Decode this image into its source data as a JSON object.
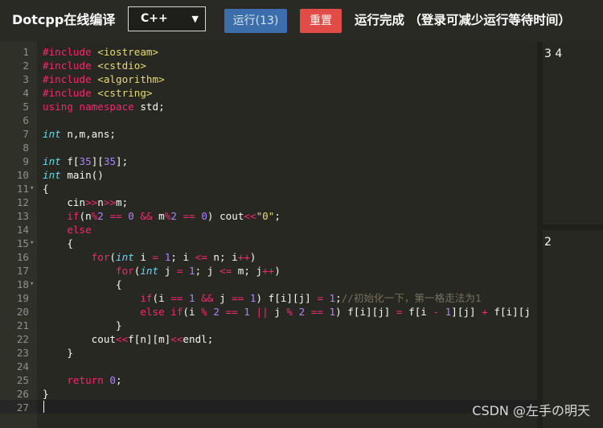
{
  "header": {
    "brand": "Dotcpp在线编译",
    "language": "C++",
    "run_label": "运行(13)",
    "reset_label": "重置",
    "status": "运行完成 （登录可减少运行等待时间）"
  },
  "editor": {
    "line_numbers": [
      "1",
      "2",
      "3",
      "4",
      "5",
      "6",
      "7",
      "8",
      "9",
      "10",
      "11",
      "12",
      "13",
      "14",
      "15",
      "16",
      "17",
      "18",
      "19",
      "20",
      "21",
      "22",
      "23",
      "24",
      "25",
      "26",
      "27"
    ],
    "fold_markers": {
      "11": "▾",
      "15": "▾",
      "18": "▾"
    },
    "lines": [
      [
        [
          "k",
          "#include "
        ],
        [
          "s",
          "<iostream>"
        ]
      ],
      [
        [
          "k",
          "#include "
        ],
        [
          "s",
          "<cstdio>"
        ]
      ],
      [
        [
          "k",
          "#include "
        ],
        [
          "s",
          "<algorithm>"
        ]
      ],
      [
        [
          "k",
          "#include "
        ],
        [
          "s",
          "<cstring>"
        ]
      ],
      [
        [
          "k",
          "using namespace "
        ],
        [
          "p",
          "std;"
        ]
      ],
      [],
      [
        [
          "t",
          "int "
        ],
        [
          "p",
          "n,m,ans;"
        ]
      ],
      [],
      [
        [
          "t",
          "int "
        ],
        [
          "p",
          "f["
        ],
        [
          "n",
          "35"
        ],
        [
          "p",
          "]["
        ],
        [
          "n",
          "35"
        ],
        [
          "p",
          "];"
        ]
      ],
      [
        [
          "t",
          "int "
        ],
        [
          "p",
          "main()"
        ]
      ],
      [
        [
          "p",
          "{"
        ]
      ],
      [
        [
          "p",
          "    cin"
        ],
        [
          "k",
          ">>"
        ],
        [
          "p",
          "n"
        ],
        [
          "k",
          ">>"
        ],
        [
          "p",
          "m;"
        ]
      ],
      [
        [
          "p",
          "    "
        ],
        [
          "k",
          "if"
        ],
        [
          "p",
          "(n"
        ],
        [
          "k",
          "%"
        ],
        [
          "n",
          "2"
        ],
        [
          "p",
          " "
        ],
        [
          "k",
          "=="
        ],
        [
          "p",
          " "
        ],
        [
          "n",
          "0"
        ],
        [
          "p",
          " "
        ],
        [
          "k",
          "&&"
        ],
        [
          "p",
          " m"
        ],
        [
          "k",
          "%"
        ],
        [
          "n",
          "2"
        ],
        [
          "p",
          " "
        ],
        [
          "k",
          "=="
        ],
        [
          "p",
          " "
        ],
        [
          "n",
          "0"
        ],
        [
          "p",
          ") cout"
        ],
        [
          "k",
          "<<"
        ],
        [
          "s",
          "\"0\""
        ],
        [
          "p",
          ";"
        ]
      ],
      [
        [
          "p",
          "    "
        ],
        [
          "k",
          "else"
        ]
      ],
      [
        [
          "p",
          "    {"
        ]
      ],
      [
        [
          "p",
          "        "
        ],
        [
          "k",
          "for"
        ],
        [
          "p",
          "("
        ],
        [
          "t",
          "int "
        ],
        [
          "p",
          "i "
        ],
        [
          "k",
          "="
        ],
        [
          "p",
          " "
        ],
        [
          "n",
          "1"
        ],
        [
          "p",
          "; i "
        ],
        [
          "k",
          "<="
        ],
        [
          "p",
          " n; i"
        ],
        [
          "k",
          "++"
        ],
        [
          "p",
          ")"
        ]
      ],
      [
        [
          "p",
          "            "
        ],
        [
          "k",
          "for"
        ],
        [
          "p",
          "("
        ],
        [
          "t",
          "int "
        ],
        [
          "p",
          "j "
        ],
        [
          "k",
          "="
        ],
        [
          "p",
          " "
        ],
        [
          "n",
          "1"
        ],
        [
          "p",
          "; j "
        ],
        [
          "k",
          "<="
        ],
        [
          "p",
          " m; j"
        ],
        [
          "k",
          "++"
        ],
        [
          "p",
          ")"
        ]
      ],
      [
        [
          "p",
          "            {"
        ]
      ],
      [
        [
          "p",
          "                "
        ],
        [
          "k",
          "if"
        ],
        [
          "p",
          "(i "
        ],
        [
          "k",
          "=="
        ],
        [
          "p",
          " "
        ],
        [
          "n",
          "1"
        ],
        [
          "p",
          " "
        ],
        [
          "k",
          "&&"
        ],
        [
          "p",
          " j "
        ],
        [
          "k",
          "=="
        ],
        [
          "p",
          " "
        ],
        [
          "n",
          "1"
        ],
        [
          "p",
          ") f[i][j] "
        ],
        [
          "k",
          "="
        ],
        [
          "p",
          " "
        ],
        [
          "n",
          "1"
        ],
        [
          "p",
          ";"
        ],
        [
          "c",
          "//初始化一下，第一格走法为1"
        ]
      ],
      [
        [
          "p",
          "                "
        ],
        [
          "k",
          "else if"
        ],
        [
          "p",
          "(i "
        ],
        [
          "k",
          "%"
        ],
        [
          "p",
          " "
        ],
        [
          "n",
          "2"
        ],
        [
          "p",
          " "
        ],
        [
          "k",
          "=="
        ],
        [
          "p",
          " "
        ],
        [
          "n",
          "1"
        ],
        [
          "p",
          " "
        ],
        [
          "k",
          "||"
        ],
        [
          "p",
          " j "
        ],
        [
          "k",
          "%"
        ],
        [
          "p",
          " "
        ],
        [
          "n",
          "2"
        ],
        [
          "p",
          " "
        ],
        [
          "k",
          "=="
        ],
        [
          "p",
          " "
        ],
        [
          "n",
          "1"
        ],
        [
          "p",
          ") f[i][j] "
        ],
        [
          "k",
          "="
        ],
        [
          "p",
          " f[i "
        ],
        [
          "k",
          "-"
        ],
        [
          "p",
          " "
        ],
        [
          "n",
          "1"
        ],
        [
          "p",
          "][j] "
        ],
        [
          "k",
          "+"
        ],
        [
          "p",
          " f[i][j"
        ]
      ],
      [
        [
          "p",
          "            }"
        ]
      ],
      [
        [
          "p",
          "        cout"
        ],
        [
          "k",
          "<<"
        ],
        [
          "p",
          "f[n][m]"
        ],
        [
          "k",
          "<<"
        ],
        [
          "p",
          "endl;"
        ]
      ],
      [
        [
          "p",
          "    }"
        ]
      ],
      [],
      [
        [
          "p",
          "    "
        ],
        [
          "k",
          "return "
        ],
        [
          "n",
          "0"
        ],
        [
          "p",
          ";"
        ]
      ],
      [
        [
          "p",
          "}"
        ]
      ],
      []
    ]
  },
  "input_panel": {
    "text": "3 4"
  },
  "output_panel": {
    "text": "2"
  },
  "watermark": "CSDN @左手の明天",
  "colors": {
    "keyword": "#f92672",
    "type": "#66d9ef",
    "number": "#ae81ff",
    "string": "#e6db74",
    "comment": "#75715e",
    "run_button": "#3b6eaa",
    "reset_button": "#e24c48"
  }
}
